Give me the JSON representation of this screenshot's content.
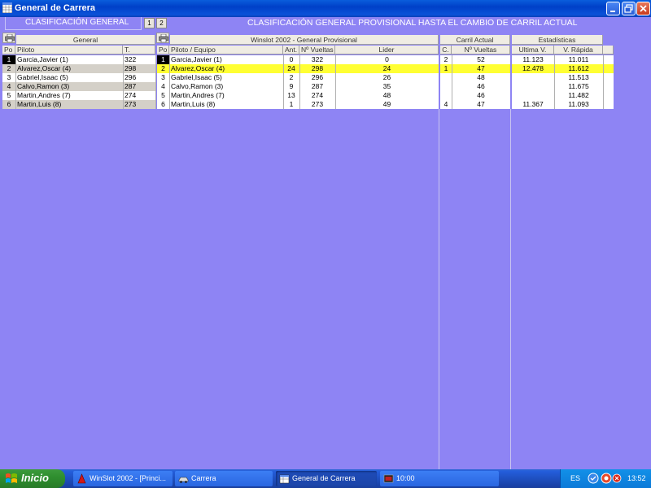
{
  "window": {
    "title": "General de Carrera"
  },
  "header": {
    "left_title": "CLASIFICACIÓN GENERAL",
    "pages": [
      "1",
      "2"
    ],
    "right_title": "CLASIFICACIÓN GENERAL PROVISIONAL HASTA EL CAMBIO DE CARRIL ACTUAL"
  },
  "general_table": {
    "group_label": "General",
    "columns": [
      "Po",
      "Piloto",
      "T."
    ],
    "rows": [
      {
        "pos": "1",
        "piloto": "Garcia,Javier (1)",
        "t": "322"
      },
      {
        "pos": "2",
        "piloto": "Alvarez,Oscar (4)",
        "t": "298"
      },
      {
        "pos": "3",
        "piloto": "Gabriel,Isaac (5)",
        "t": "296"
      },
      {
        "pos": "4",
        "piloto": "Calvo,Ramon (3)",
        "t": "287"
      },
      {
        "pos": "5",
        "piloto": "Martin,Andres (7)",
        "t": "274"
      },
      {
        "pos": "6",
        "piloto": "Martin,Luis (8)",
        "t": "273"
      }
    ]
  },
  "provisional_table": {
    "group_label": "Winslot 2002  -  General Provisional",
    "columns": [
      "Po",
      "Piloto / Equipo",
      "Ant.",
      "Nº Vueltas",
      "Lider"
    ],
    "rows": [
      {
        "pos": "1",
        "piloto": "Garcia,Javier (1)",
        "ant": "0",
        "vueltas": "322",
        "lider": "0"
      },
      {
        "pos": "2",
        "piloto": "Alvarez,Oscar (4)",
        "ant": "24",
        "vueltas": "298",
        "lider": "24"
      },
      {
        "pos": "3",
        "piloto": "Gabriel,Isaac (5)",
        "ant": "2",
        "vueltas": "296",
        "lider": "26"
      },
      {
        "pos": "4",
        "piloto": "Calvo,Ramon (3)",
        "ant": "9",
        "vueltas": "287",
        "lider": "35"
      },
      {
        "pos": "5",
        "piloto": "Martin,Andres (7)",
        "ant": "13",
        "vueltas": "274",
        "lider": "48"
      },
      {
        "pos": "6",
        "piloto": "Martin,Luis (8)",
        "ant": "1",
        "vueltas": "273",
        "lider": "49"
      }
    ]
  },
  "carril_table": {
    "group_label": "Carril Actual",
    "columns": [
      "C.",
      "Nº Vueltas"
    ],
    "rows": [
      {
        "c": "2",
        "vueltas": "52"
      },
      {
        "c": "1",
        "vueltas": "47"
      },
      {
        "c": "",
        "vueltas": "48"
      },
      {
        "c": "",
        "vueltas": "46"
      },
      {
        "c": "",
        "vueltas": "46"
      },
      {
        "c": "4",
        "vueltas": "47"
      }
    ]
  },
  "stats_table": {
    "group_label": "Estadísticas",
    "columns": [
      "Ultima V.",
      "V. Rápida"
    ],
    "rows": [
      {
        "ultima": "11.123",
        "rapida": "11.011"
      },
      {
        "ultima": "12.478",
        "rapida": "11.612"
      },
      {
        "ultima": "",
        "rapida": "11.513"
      },
      {
        "ultima": "",
        "rapida": "11.675"
      },
      {
        "ultima": "",
        "rapida": "11.482"
      },
      {
        "ultima": "11.367",
        "rapida": "11.093"
      }
    ]
  },
  "taskbar": {
    "start_label": "Inicio",
    "tasks": [
      "WinSlot 2002 - [Princi...",
      "Carrera",
      "General de Carrera",
      "10:00"
    ],
    "lang": "ES",
    "clock": "13:52"
  },
  "colors": {
    "background": "#8e84f4",
    "highlight_row": "#ffff33",
    "alt_row": "#d4d0c8",
    "titlebar": "#0040c8"
  }
}
